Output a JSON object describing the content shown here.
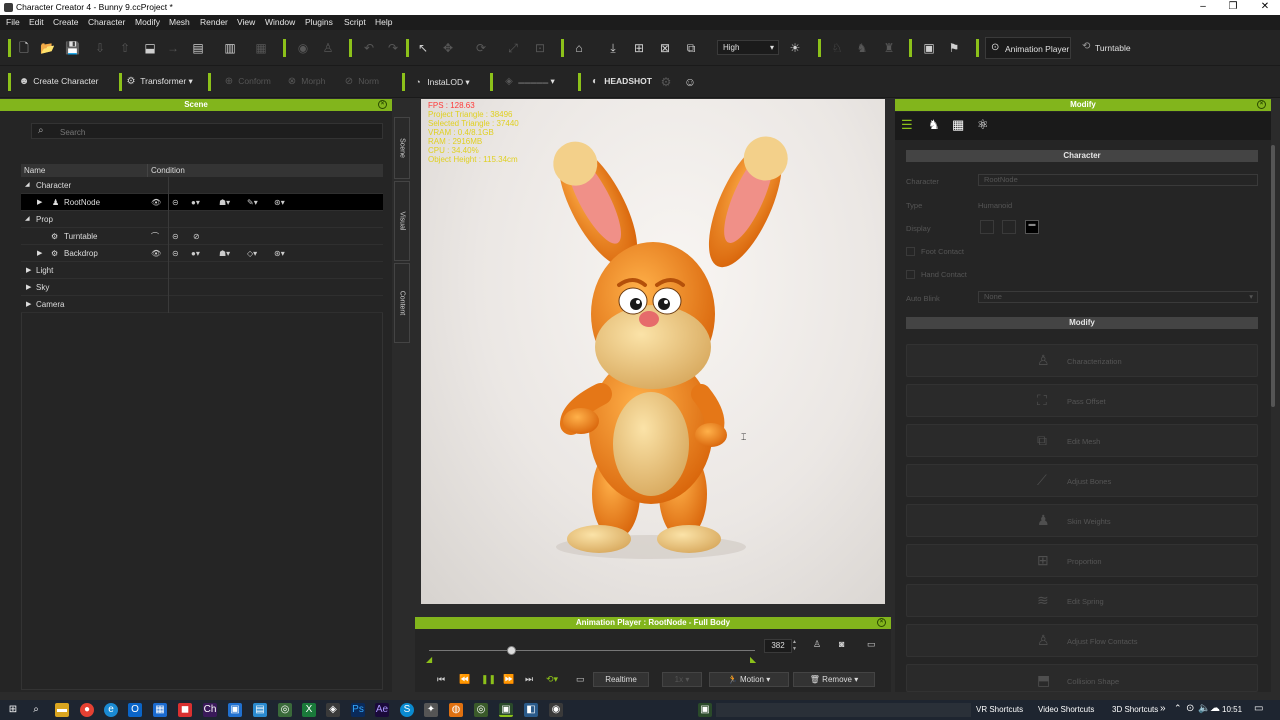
{
  "window": {
    "title": "Character Creator 4 - Bunny 9.ccProject *"
  },
  "menu": [
    "File",
    "Edit",
    "Create",
    "Character",
    "Modify",
    "Mesh",
    "Render",
    "View",
    "Window",
    "Plugins",
    "Script",
    "Help"
  ],
  "toolbar1": {
    "quality": "High",
    "animation_player": "Animation Player",
    "turntable": "Turntable"
  },
  "toolbar2": {
    "create_character": "Create Character",
    "transformer": "Transformer",
    "conform": "Conform",
    "morph": "Morph",
    "norm": "Norm",
    "instalod": "InstaLOD",
    "headshot": "HEADSHOT"
  },
  "scene": {
    "title": "Scene",
    "search_placeholder": "Search",
    "col_name": "Name",
    "col_condition": "Condition",
    "rows": [
      "Character",
      "RootNode",
      "Prop",
      "Turntable",
      "Backdrop",
      "Light",
      "Sky",
      "Camera"
    ]
  },
  "sidetabs": {
    "scene": "Scene",
    "visual": "Visual",
    "content": "Content"
  },
  "stats": {
    "fps": "FPS : 128.63",
    "project_triangle": "Project Triangle : 38496",
    "selected_triangle": "Selected Triangle : 37440",
    "vram": "VRAM : 0.4/8.1GB",
    "ram": "RAM : 2916MB",
    "cpu": "CPU : 34.40%",
    "object_height": "Object Height : 115.34cm"
  },
  "animplayer": {
    "title": "Animation Player : RootNode - Full Body",
    "frame": "382",
    "realtime": "Realtime",
    "motion": "Motion",
    "remove": "Remove",
    "progress": 0.25
  },
  "modify": {
    "title": "Modify",
    "section_character": "Character",
    "character_label": "Character",
    "character_value": "RootNode",
    "type_label": "Type",
    "type_value": "Humanoid",
    "display_label": "Display",
    "foot_contact": "Foot Contact",
    "hand_contact": "Hand Contact",
    "auto_blink_label": "Auto Blink",
    "auto_blink_value": "None",
    "section_modify": "Modify",
    "buttons": [
      "Characterization",
      "Pass Offset",
      "Edit Mesh",
      "Adjust Bones",
      "Skin Weights",
      "Proportion",
      "Edit Spring",
      "Adjust Flow Contacts",
      "Collision Shape"
    ]
  },
  "taskbar": {
    "vr_shortcuts": "VR Shortcuts",
    "video_shortcuts": "Video Shortcuts",
    "shortcuts_3d": "3D Shortcuts",
    "time": "10:51"
  },
  "colors": {
    "accent": "#82b51c",
    "bunny_orange": "#f08a1e",
    "bunny_cream": "#f0cd88"
  }
}
